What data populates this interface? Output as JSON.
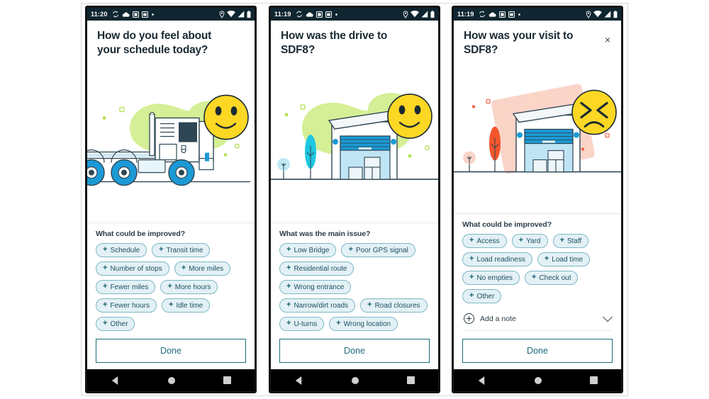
{
  "screens": [
    {
      "id": "schedule-feedback",
      "status": {
        "time": "11:20",
        "left_icons": [
          "sync-icon",
          "cloud-icon",
          "screenshot-icon",
          "app-icon",
          "dot-icon"
        ],
        "right_icons": [
          "location-pin-icon",
          "wifi-icon",
          "signal-icon",
          "battery-icon"
        ]
      },
      "title": "How do you feel about your schedule today?",
      "close_label": "",
      "illustration": "truck-illustration",
      "emoji": "happy-face",
      "sheet_title": "What could be improved?",
      "chips": [
        "Schedule",
        "Transit time",
        "Number of stops",
        "More miles",
        "Fewer miles",
        "More hours",
        "Fewer hours",
        "Idle time",
        "Other"
      ],
      "done_label": "Done",
      "nav": [
        "back-icon",
        "home-icon",
        "recents-icon"
      ]
    },
    {
      "id": "drive-feedback",
      "status": {
        "time": "11:19",
        "left_icons": [
          "sync-icon",
          "cloud-icon",
          "screenshot-icon",
          "app-icon",
          "dot-icon"
        ],
        "right_icons": [
          "location-pin-icon",
          "wifi-icon",
          "signal-icon",
          "battery-icon"
        ]
      },
      "title": "How was the drive to SDF8?",
      "illustration": "warehouse-illustration",
      "emoji": "happy-face",
      "sheet_title": "What was the main issue?",
      "chips": [
        "Low Bridge",
        "Poor GPS signal",
        "Residential route",
        "Wrong entrance",
        "Narrow/dirt roads",
        "Road closures",
        "U-turns",
        "Wrong location"
      ],
      "done_label": "Done",
      "nav": [
        "back-icon",
        "home-icon",
        "recents-icon"
      ]
    },
    {
      "id": "visit-feedback",
      "status": {
        "time": "11:19",
        "left_icons": [
          "sync-icon",
          "cloud-icon",
          "screenshot-icon",
          "app-icon",
          "dot-icon"
        ],
        "right_icons": [
          "location-pin-icon",
          "wifi-icon",
          "signal-icon",
          "battery-icon"
        ]
      },
      "title": "How was your visit to SDF8?",
      "close_label": "×",
      "illustration": "warehouse-illustration-red",
      "emoji": "frustrated-face",
      "sheet_title": "What could be improved?",
      "chips": [
        "Access",
        "Yard",
        "Staff",
        "Load readiness",
        "Load time",
        "No empties",
        "Check out",
        "Other"
      ],
      "note_label": "Add a note",
      "done_label": "Done",
      "nav": [
        "back-icon",
        "home-icon",
        "recents-icon"
      ]
    }
  ],
  "colors": {
    "status_bar": "#0f2630",
    "chip_fill": "#e3f1f6",
    "chip_border": "#7fb6c4",
    "chip_text": "#1e4f5e",
    "accent_teal": "#1c6b7a",
    "emoji_yellow": "#fcd723",
    "blob_green": "#d4ef95",
    "blob_pink": "#fbd4c8",
    "truck_blue": "#1c9ad6",
    "nav_bar": "#000000"
  }
}
